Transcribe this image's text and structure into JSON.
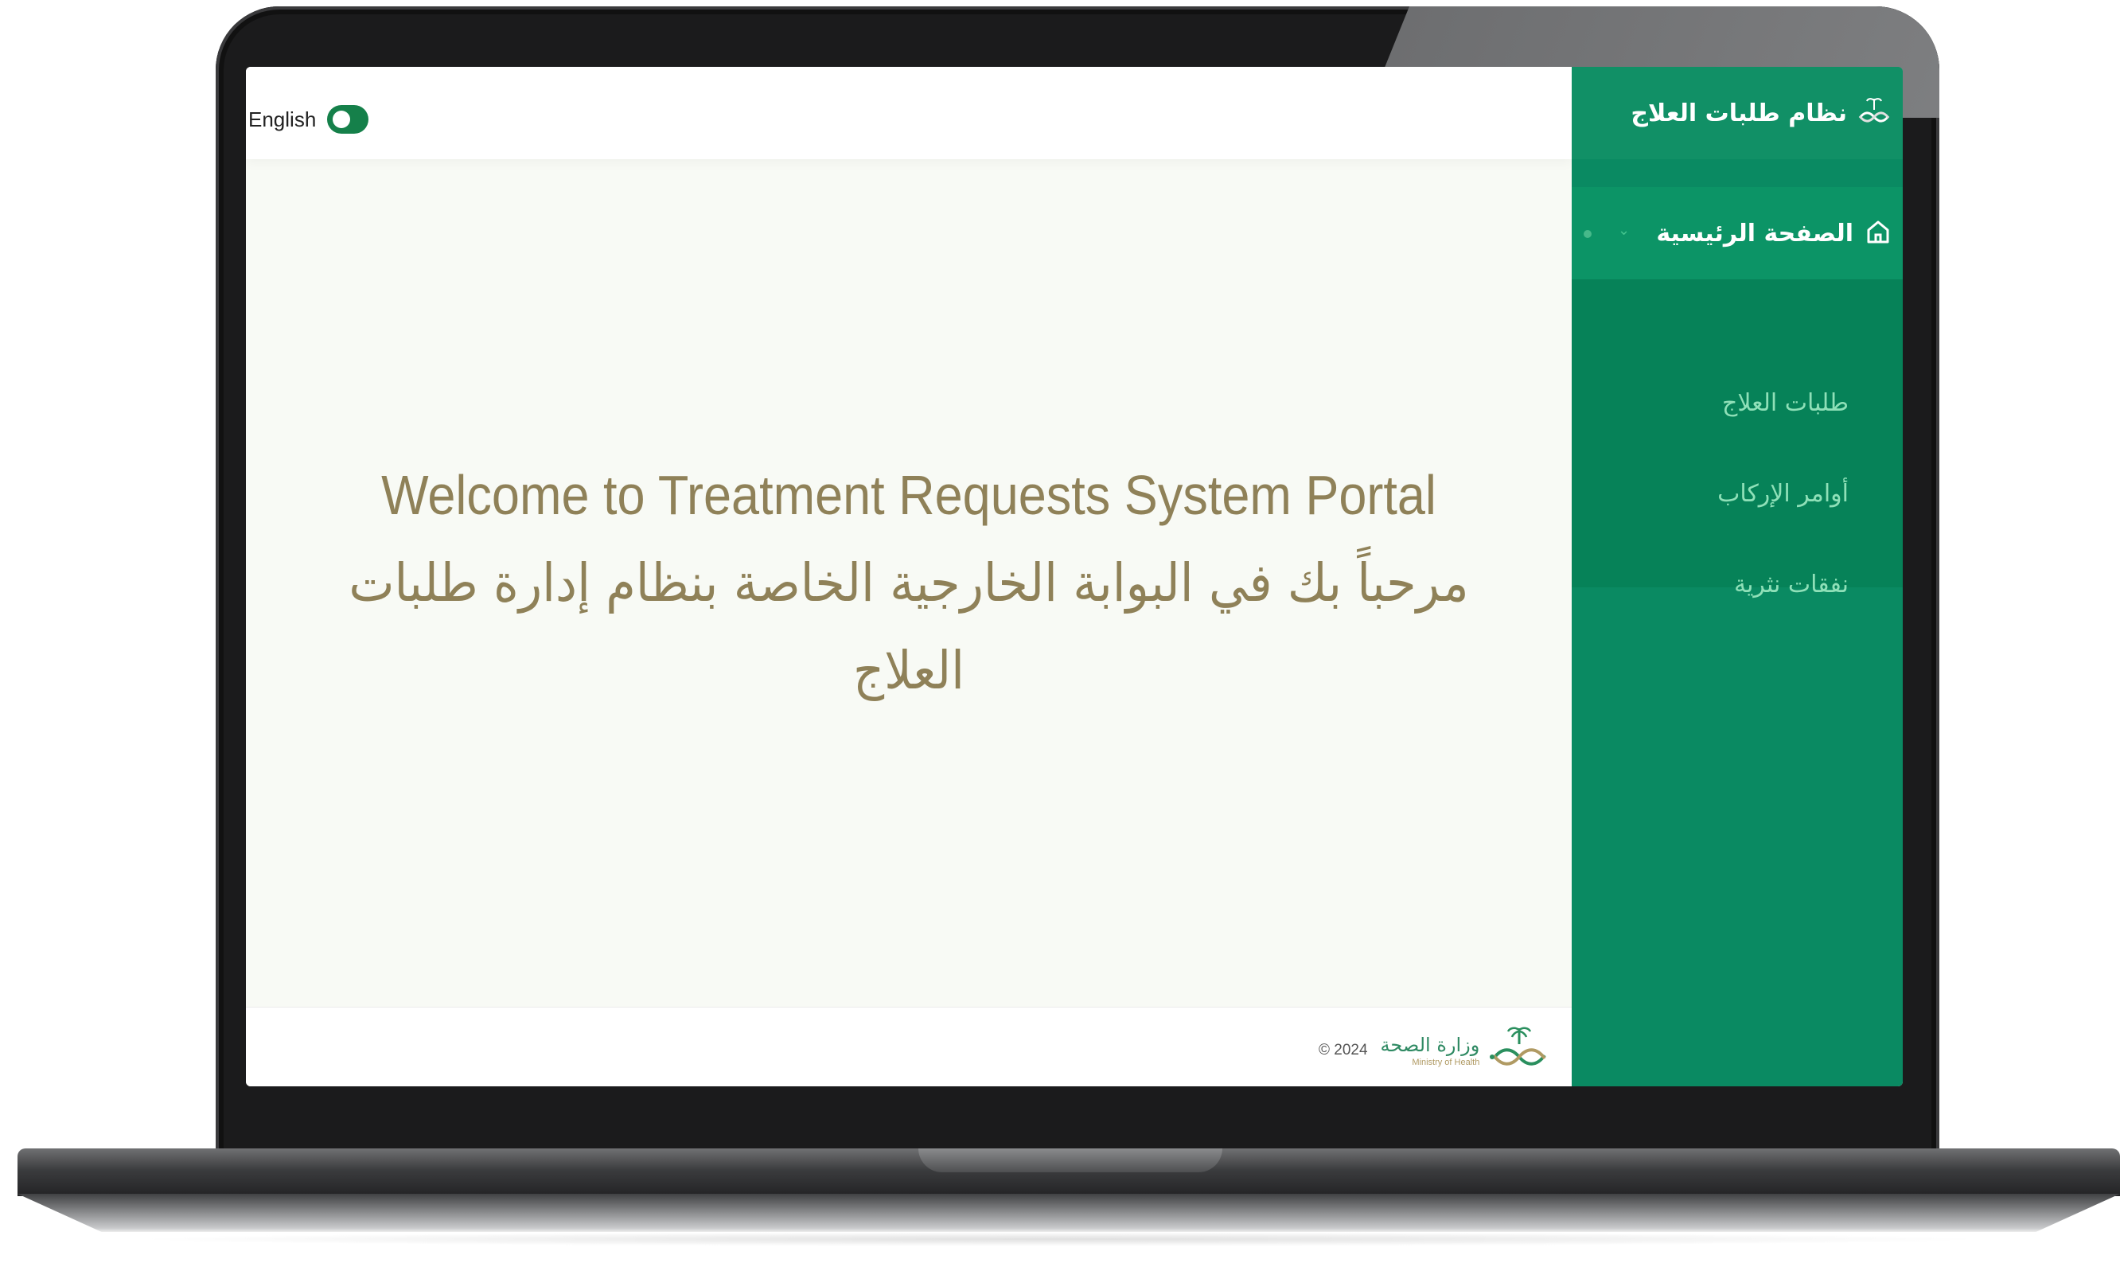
{
  "topbar": {
    "language_label": "English"
  },
  "welcome": {
    "title_en": "Welcome to Treatment Requests System Portal",
    "title_ar": "مرحباً بك في البوابة الخارجية الخاصة بنظام إدارة طلبات العلاج"
  },
  "sidebar": {
    "app_title": "نظام طلبات العلاج",
    "home_label": "الصفحة الرئيسية",
    "items": [
      {
        "label": "طلبات العلاج"
      },
      {
        "label": "أوامر الإركاب"
      },
      {
        "label": "نفقات نثرية"
      }
    ]
  },
  "footer": {
    "copyright": "© 2024",
    "ministry_ar": "وزارة الصحة",
    "ministry_en": "Ministry of Health"
  },
  "colors": {
    "sidebar_green": "#0a8a62",
    "accent_green": "#15804a",
    "welcome_text": "#8f8158"
  },
  "icons": {
    "logo": "ministry-logo-icon",
    "home": "home-icon",
    "chevron": "chevron-down-icon"
  }
}
